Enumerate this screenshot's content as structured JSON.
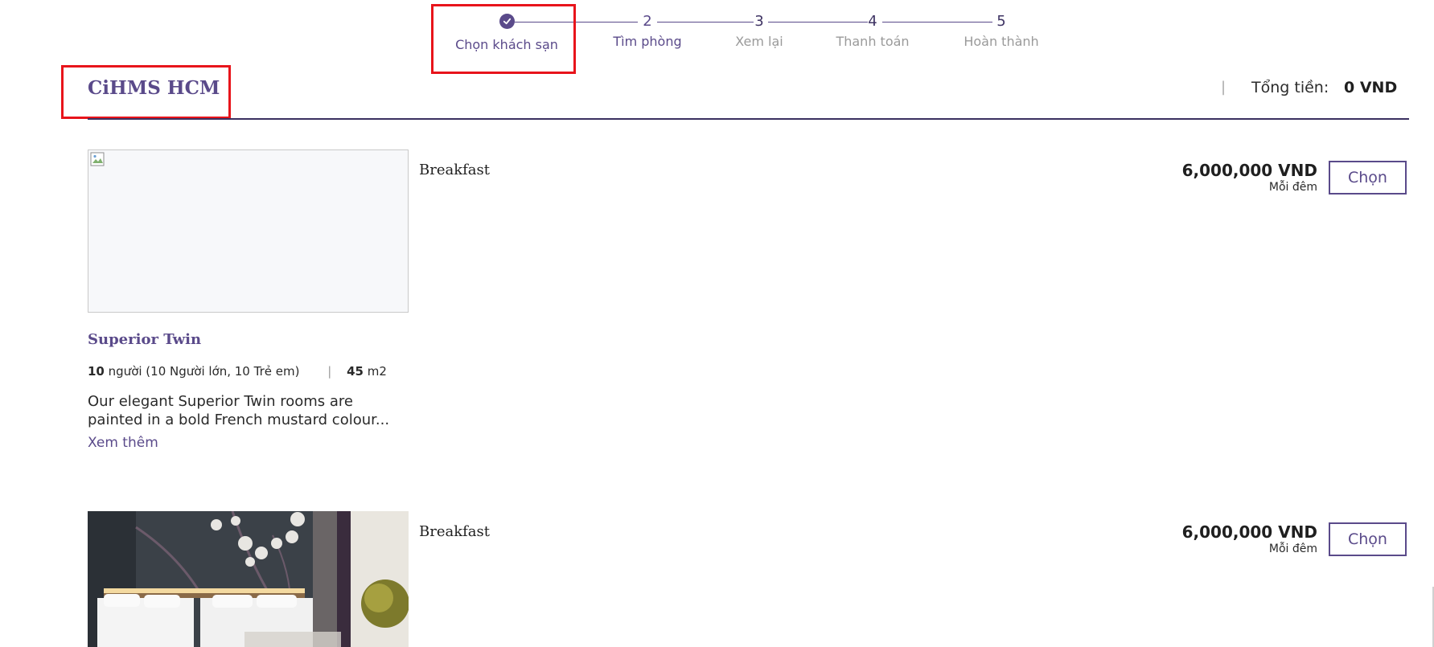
{
  "stepper": {
    "steps": [
      {
        "number": "",
        "label": "Chọn khách sạn",
        "state": "done"
      },
      {
        "number": "2",
        "label": "Tìm phòng",
        "state": "active"
      },
      {
        "number": "3",
        "label": "Xem lại",
        "state": "upcoming"
      },
      {
        "number": "4",
        "label": "Thanh toán",
        "state": "upcoming"
      },
      {
        "number": "5",
        "label": "Hoàn thành",
        "state": "upcoming"
      }
    ]
  },
  "header": {
    "hotel_name": "CiHMS HCM",
    "separator": "|",
    "total_label": "Tổng tiền:",
    "total_value": "0 VND"
  },
  "rooms": [
    {
      "plan": "Breakfast",
      "price": "6,000,000 VND",
      "price_unit": "Mỗi đêm",
      "choose_label": "Chọn",
      "title": "Superior Twin",
      "guests_count": "10",
      "guests_text": "người (10 Người lớn, 10 Trẻ em)",
      "area_value": "45",
      "area_unit": "m2",
      "description_line1": "Our elegant Superior Twin rooms are",
      "description_line2": "painted in a bold French mustard colour...",
      "see_more": "Xem thêm",
      "image": "broken-image-icon"
    },
    {
      "plan": "Breakfast",
      "price": "6,000,000 VND",
      "price_unit": "Mỗi đêm",
      "choose_label": "Chọn",
      "image": "hotel-twin-room-photo"
    }
  ],
  "colors": {
    "accent": "#5a4a8a",
    "highlight_box": "#e8141b"
  }
}
